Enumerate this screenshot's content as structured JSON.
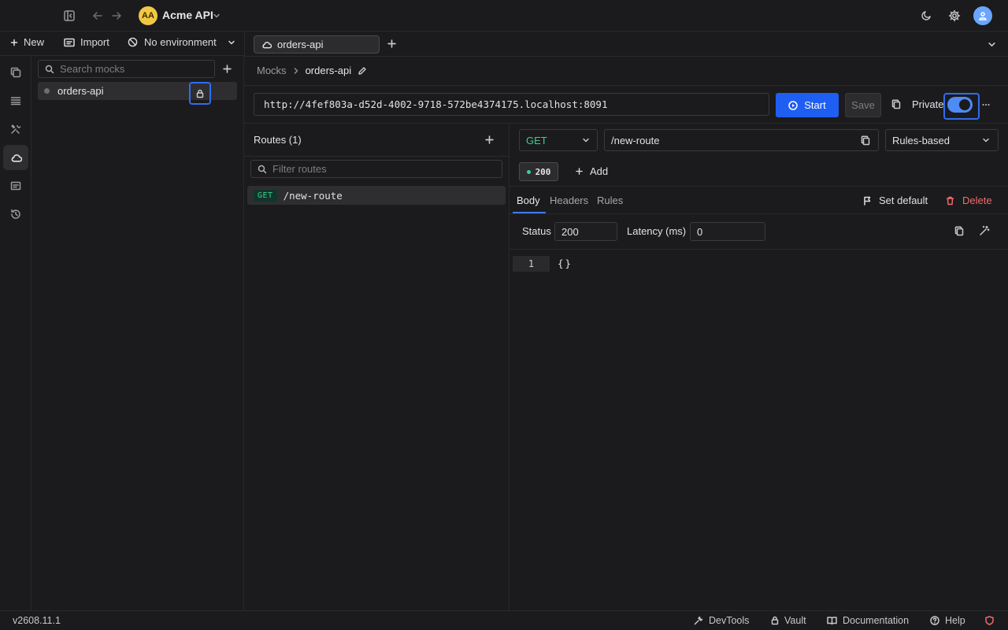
{
  "workspace": {
    "initials": "AA",
    "name": "Acme API"
  },
  "toolbar": {
    "new_label": "New",
    "import_label": "Import",
    "environment_label": "No environment"
  },
  "tabs": [
    {
      "label": "orders-api"
    }
  ],
  "sidebar": {
    "search_placeholder": "Search mocks",
    "mocks": [
      {
        "name": "orders-api",
        "locked": true
      }
    ]
  },
  "breadcrumb": {
    "root": "Mocks",
    "current": "orders-api"
  },
  "mock": {
    "url": "http://4fef803a-d52d-4002-9718-572be4374175.localhost:8091",
    "start_label": "Start",
    "save_label": "Save",
    "private_label": "Private",
    "private_enabled": true
  },
  "routes": {
    "header": "Routes (1)",
    "filter_placeholder": "Filter routes",
    "items": [
      {
        "method": "GET",
        "path": "/new-route"
      }
    ]
  },
  "route_editor": {
    "method": "GET",
    "path": "/new-route",
    "mode": "Rules-based",
    "responses": [
      {
        "status": "200"
      }
    ],
    "add_label": "Add",
    "tabs": [
      "Body",
      "Headers",
      "Rules"
    ],
    "active_tab": "Body",
    "set_default_label": "Set default",
    "delete_label": "Delete",
    "status_label": "Status",
    "status_value": "200",
    "latency_label": "Latency (ms)",
    "latency_value": "0",
    "code_lines": [
      {
        "number": "1",
        "text": "{}"
      }
    ]
  },
  "statusbar": {
    "version": "v2608.11.1",
    "devtools_label": "DevTools",
    "vault_label": "Vault",
    "documentation_label": "Documentation",
    "help_label": "Help"
  },
  "colors": {
    "accent": "#1f5ef2",
    "method_get": "#3ccf8e",
    "danger": "#f16b6b",
    "workspace_avatar": "#f2c744",
    "toggle_on": "#4f8bf5"
  }
}
